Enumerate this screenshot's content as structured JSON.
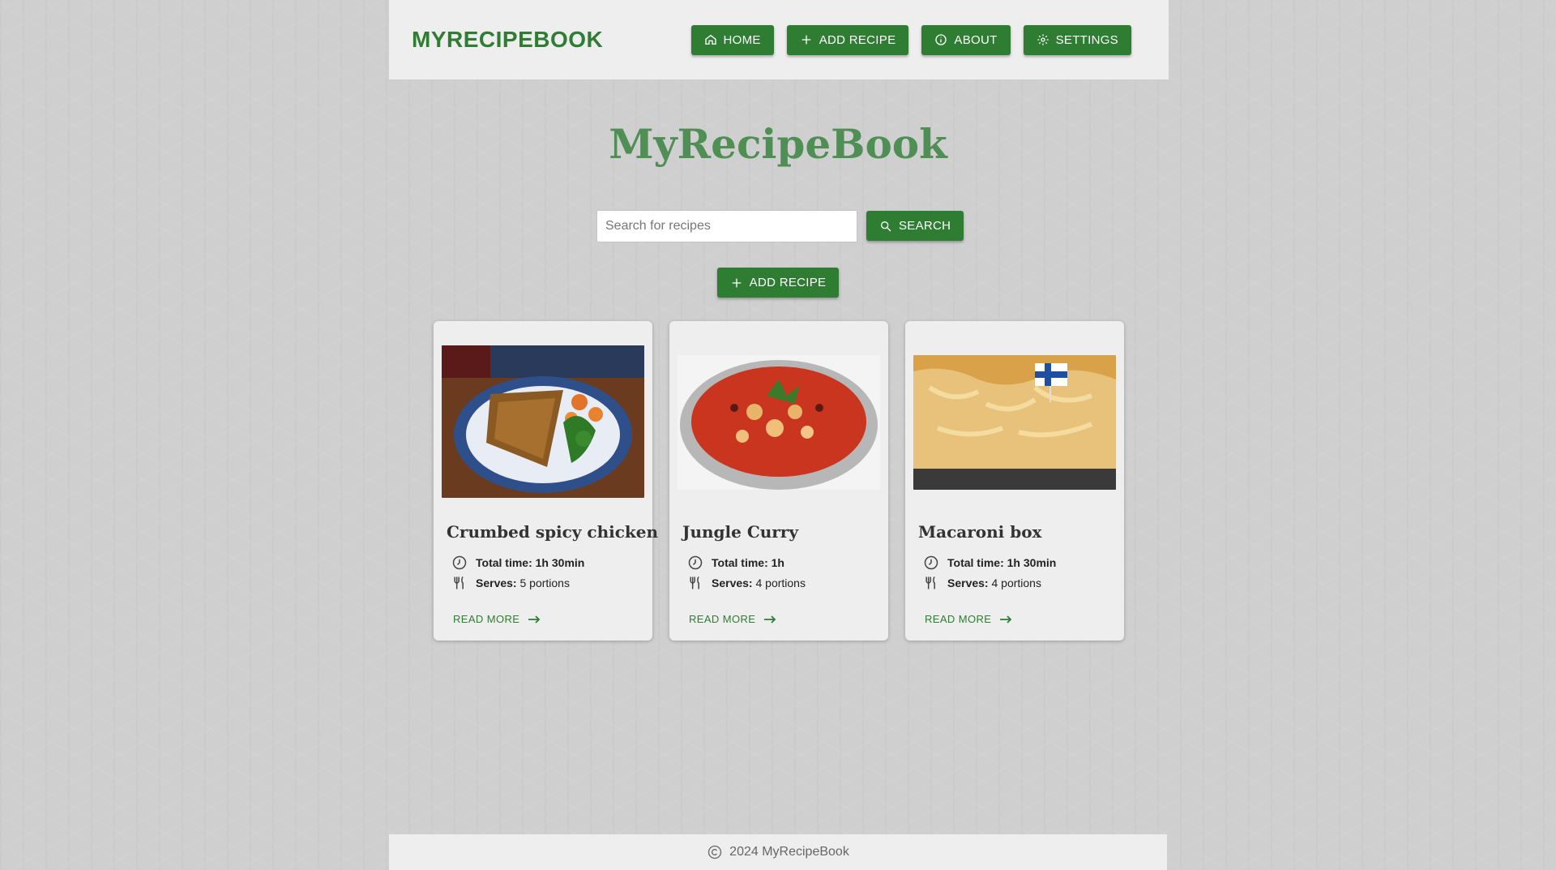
{
  "header": {
    "brand": "MYRECIPEBOOK",
    "nav": [
      {
        "label": "HOME",
        "icon": "home-icon"
      },
      {
        "label": "ADD RECIPE",
        "icon": "plus-icon"
      },
      {
        "label": "ABOUT",
        "icon": "info-icon"
      },
      {
        "label": "SETTINGS",
        "icon": "gear-icon"
      }
    ]
  },
  "hero": {
    "title": "MyRecipeBook"
  },
  "search": {
    "placeholder": "Search for recipes",
    "value": "",
    "button_label": "SEARCH"
  },
  "add_recipe": {
    "label": "ADD RECIPE"
  },
  "recipes": [
    {
      "title": "Crumbed spicy chicken",
      "time_label": "Total time:",
      "time": "1h 30min",
      "serves_label": "Serves:",
      "serves": "5 portions",
      "read_more": "READ MORE"
    },
    {
      "title": "Jungle Curry",
      "time_label": "Total time:",
      "time": "1h",
      "serves_label": "Serves:",
      "serves": "4 portions",
      "read_more": "READ MORE"
    },
    {
      "title": "Macaroni box",
      "time_label": "Total time:",
      "time": "1h 30min",
      "serves_label": "Serves:",
      "serves": "4 portions",
      "read_more": "READ MORE"
    }
  ],
  "footer": {
    "text": "2024 MyRecipeBook"
  },
  "colors": {
    "accent": "#2e7d32",
    "hero_title": "#4f8f55",
    "panel": "#eeeeee",
    "background": "#cfcfcf"
  }
}
